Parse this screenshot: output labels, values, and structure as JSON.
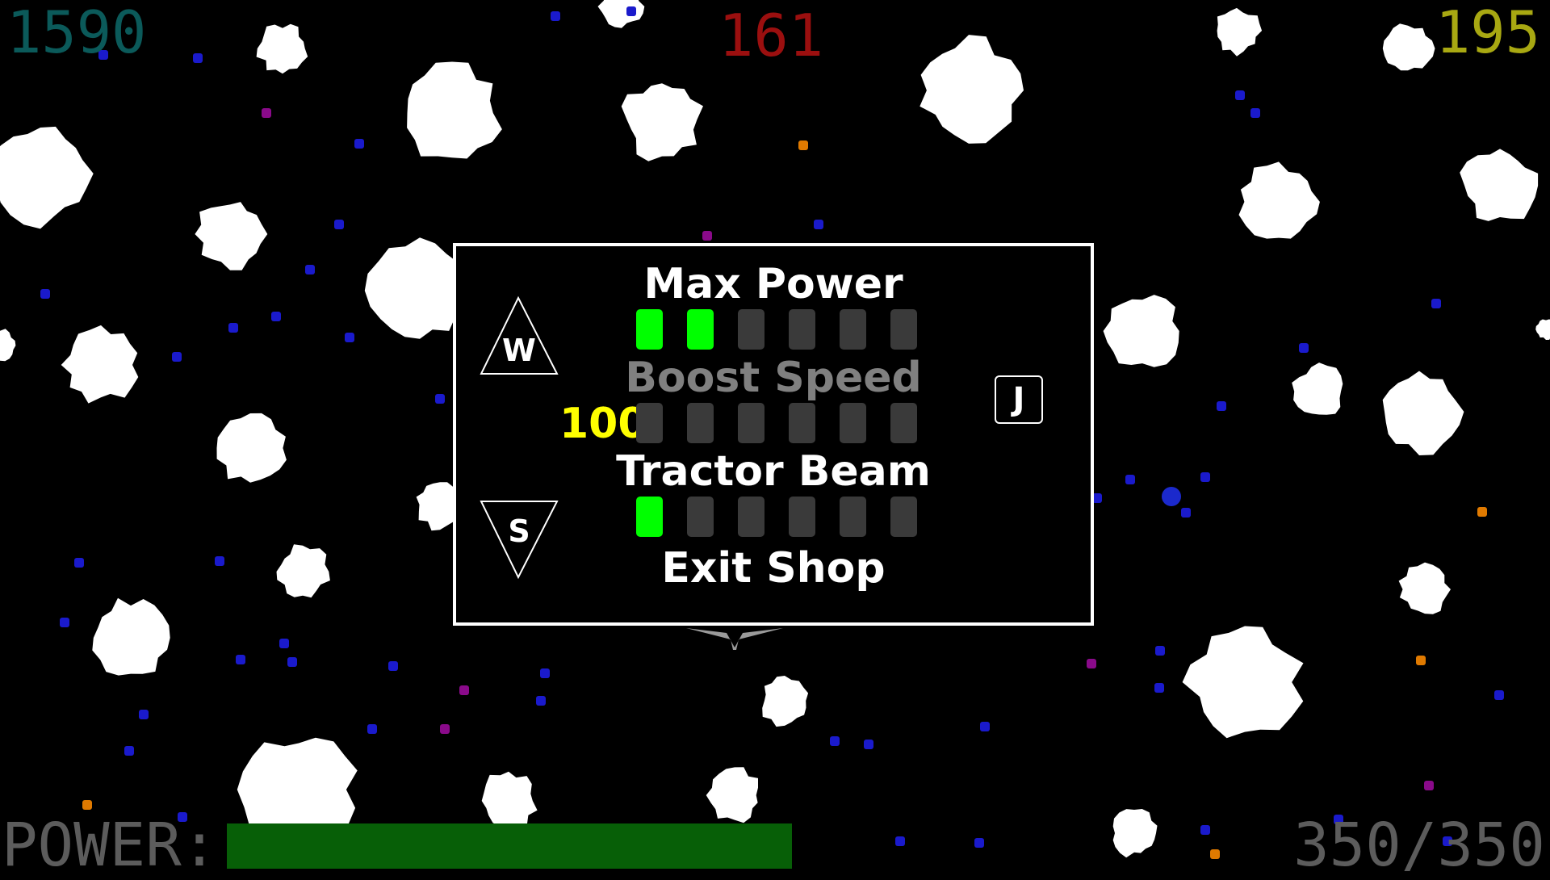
{
  "hud": {
    "score": "1590",
    "score_color": "#0b5a5a",
    "timer": "161",
    "timer_color": "#9b0f0f",
    "coins": "195",
    "coins_color": "#a8a812",
    "power_label": "POWER:",
    "power_readout": "350/350",
    "power_text_color": "#5c5c5c",
    "power_level": 1.0,
    "power_bar_color": "#075f07"
  },
  "shop": {
    "options": [
      {
        "title": "Max Power",
        "level": 2,
        "max_level": 6,
        "selected": false
      },
      {
        "title": "Boost Speed",
        "level": 0,
        "max_level": 6,
        "selected": true
      },
      {
        "title": "Tractor Beam",
        "level": 1,
        "max_level": 6,
        "selected": false
      }
    ],
    "cost": "100",
    "exit_label": "Exit Shop",
    "up_key": "W",
    "down_key": "S",
    "confirm_key": "J",
    "colors": {
      "filled": "#00ff00",
      "empty": "#3a3a3a",
      "title": "#ffffff",
      "title_selected": "#808080",
      "cost": "#ffff00"
    }
  },
  "entities": {
    "asteroid_icon": "asteroid-icon",
    "debris_icon": "debris-particle-icon",
    "ship_icon": "player-ship-icon",
    "debris_colors": [
      "#1a1acc",
      "#8a0a8a",
      "#e07a00"
    ]
  }
}
